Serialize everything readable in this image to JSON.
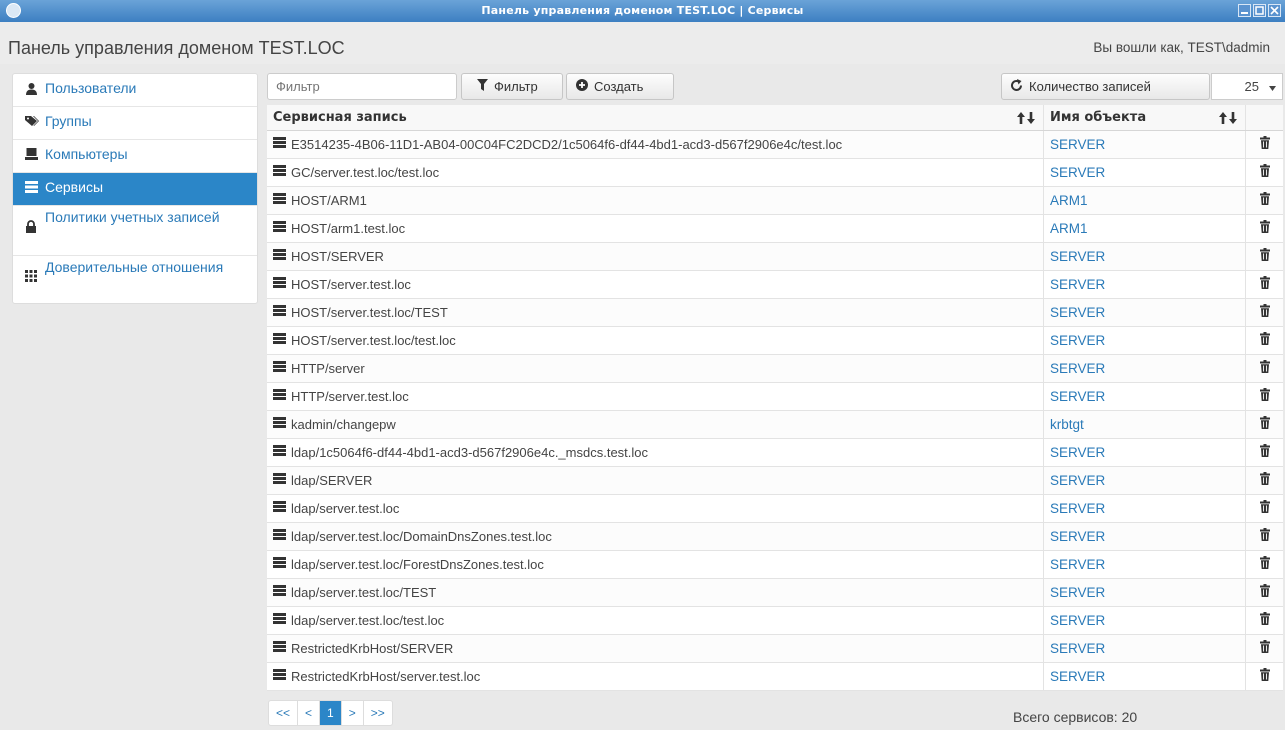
{
  "window": {
    "title": "Панель управления доменом TEST.LOC | Сервисы"
  },
  "header": {
    "title": "Панель управления доменом TEST.LOC",
    "logged_in": "Вы вошли как, TEST\\dadmin"
  },
  "sidebar": {
    "items": [
      {
        "label": "Пользователи",
        "icon": "user-icon"
      },
      {
        "label": "Группы",
        "icon": "tags-icon"
      },
      {
        "label": "Компьютеры",
        "icon": "computer-icon"
      },
      {
        "label": "Сервисы",
        "icon": "server-icon",
        "active": true
      },
      {
        "label": "Политики учетных записей",
        "icon": "lock-icon"
      },
      {
        "label": "Доверительные отношения",
        "icon": "grid-icon"
      }
    ]
  },
  "toolbar": {
    "filter_placeholder": "Фильтр",
    "filter_button": "Фильтр",
    "create_button": "Создать",
    "records_label": "Количество записей",
    "records_value": "25"
  },
  "table": {
    "columns": [
      "Сервисная запись",
      "Имя объекта"
    ],
    "rows": [
      {
        "service": "E3514235-4B06-11D1-AB04-00C04FC2DCD2/1c5064f6-df44-4bd1-acd3-d567f2906e4c/test.loc",
        "object": "SERVER"
      },
      {
        "service": "GC/server.test.loc/test.loc",
        "object": "SERVER"
      },
      {
        "service": "HOST/ARM1",
        "object": "ARM1"
      },
      {
        "service": "HOST/arm1.test.loc",
        "object": "ARM1"
      },
      {
        "service": "HOST/SERVER",
        "object": "SERVER"
      },
      {
        "service": "HOST/server.test.loc",
        "object": "SERVER"
      },
      {
        "service": "HOST/server.test.loc/TEST",
        "object": "SERVER"
      },
      {
        "service": "HOST/server.test.loc/test.loc",
        "object": "SERVER"
      },
      {
        "service": "HTTP/server",
        "object": "SERVER"
      },
      {
        "service": "HTTP/server.test.loc",
        "object": "SERVER"
      },
      {
        "service": "kadmin/changepw",
        "object": "krbtgt"
      },
      {
        "service": "ldap/1c5064f6-df44-4bd1-acd3-d567f2906e4c._msdcs.test.loc",
        "object": "SERVER"
      },
      {
        "service": "ldap/SERVER",
        "object": "SERVER"
      },
      {
        "service": "ldap/server.test.loc",
        "object": "SERVER"
      },
      {
        "service": "ldap/server.test.loc/DomainDnsZones.test.loc",
        "object": "SERVER"
      },
      {
        "service": "ldap/server.test.loc/ForestDnsZones.test.loc",
        "object": "SERVER"
      },
      {
        "service": "ldap/server.test.loc/TEST",
        "object": "SERVER"
      },
      {
        "service": "ldap/server.test.loc/test.loc",
        "object": "SERVER"
      },
      {
        "service": "RestrictedKrbHost/SERVER",
        "object": "SERVER"
      },
      {
        "service": "RestrictedKrbHost/server.test.loc",
        "object": "SERVER"
      }
    ]
  },
  "pagination": {
    "first": "<<",
    "prev": "<",
    "current": "1",
    "next": ">",
    "last": ">>"
  },
  "footer": {
    "total": "Всего сервисов: 20"
  },
  "colors": {
    "accent": "#2b86c8",
    "link": "#2a7ab8",
    "titlebar": "#3d7fc2"
  }
}
